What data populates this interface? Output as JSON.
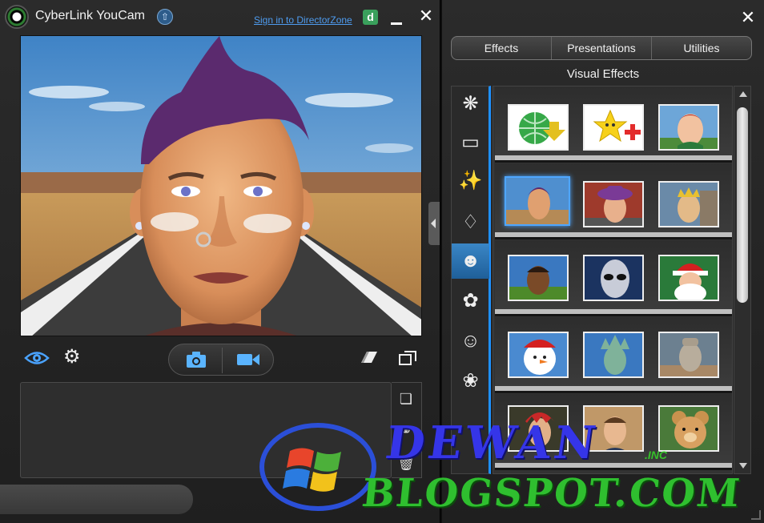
{
  "left_window": {
    "title": "CyberLink YouCam",
    "signin_link": "Sign in to DirectorZone",
    "directorzone_badge": "d",
    "minimize_icon": "minimize-icon",
    "close_icon": "close-icon"
  },
  "right_window": {
    "tabs": [
      "Effects",
      "Presentations",
      "Utilities"
    ],
    "section_title": "Visual Effects",
    "categories": [
      "frame-effects",
      "screen-frame",
      "magic-wand",
      "mask",
      "avatar",
      "particle",
      "emotion",
      "special"
    ],
    "active_category": "avatar"
  },
  "watermark": {
    "line1": "DEWAN",
    "suffix": ".INC",
    "line2": "BLOGSPOT.COM"
  },
  "colors": {
    "accent": "#1e90ff",
    "window_bg": "#262626",
    "watermark_blue": "#3535e8",
    "watermark_green": "#2fbf2f"
  }
}
